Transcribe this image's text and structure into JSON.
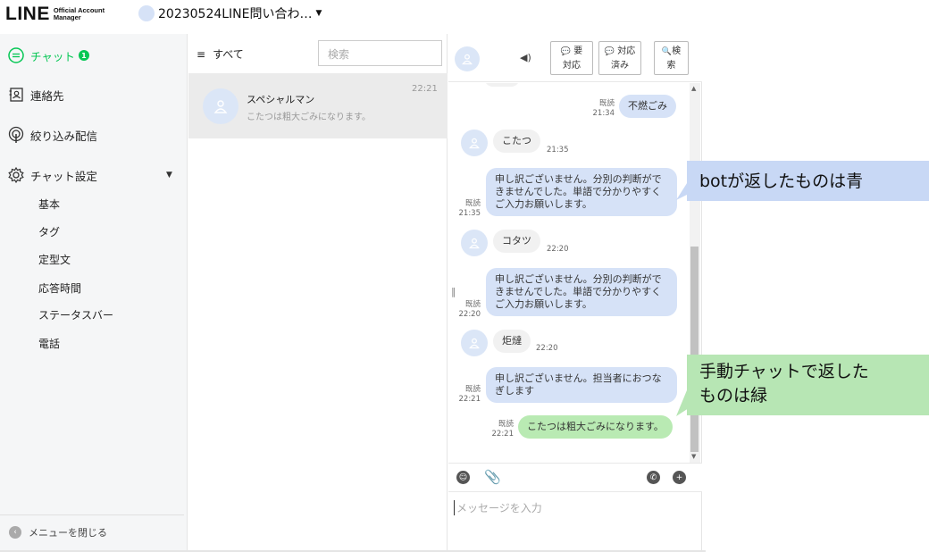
{
  "header": {
    "logo_main": "LINE",
    "logo_sub": "Official Account Manager",
    "account_name": "20230524LINE問い合わ…"
  },
  "sidebar": {
    "chat_label": "チャット",
    "chat_badge": "1",
    "contacts_label": "連絡先",
    "filtered_broadcast_label": "絞り込み配信",
    "chat_settings_label": "チャット設定",
    "sub_items": [
      "基本",
      "タグ",
      "定型文",
      "応答時間",
      "ステータスバー",
      "電話"
    ],
    "close_menu_label": "メニューを閉じる"
  },
  "chatlist": {
    "filter_label": "すべて",
    "search_placeholder": "検索",
    "conversation": {
      "name": "スペシャルマン",
      "preview": "こたつは粗大ごみになります。",
      "time": "22:21"
    }
  },
  "chat": {
    "buttons": {
      "needs_action_1": "要",
      "needs_action_2": "対応",
      "done_1": "対応",
      "done_2": "済み",
      "search_1": "検",
      "search_2": "索"
    },
    "messages": {
      "m1_text": "不燃ごみ",
      "m1_read": "既読",
      "m1_time": "21:34",
      "m2_text": "こたつ",
      "m2_time": "21:35",
      "m3_line1": "申し訳ございません。分別の判断がで",
      "m3_line2": "きませんでした。単語で分かりやすく",
      "m3_line3": "ご入力お願いします。",
      "m3_read": "既読",
      "m3_time": "21:35",
      "m4_text": "コタツ",
      "m4_time": "22:20",
      "m5_line1": "申し訳ございません。分別の判断がで",
      "m5_line2": "きませんでした。単語で分かりやすく",
      "m5_line3": "ご入力お願いします。",
      "m5_read": "既読",
      "m5_time": "22:20",
      "m6_text": "炬燵",
      "m6_time": "22:20",
      "m7_line1": "申し訳ございません。担当者におつな",
      "m7_line2": "ぎします",
      "m7_read": "既読",
      "m7_time": "22:21",
      "m8_text": "こたつは粗大ごみになります。",
      "m8_read": "既読",
      "m8_time": "22:21"
    },
    "input_placeholder": "メッセージを入力"
  },
  "annotations": {
    "bot_blue": "botが返したものは青",
    "manual_green_1": "手動チャットで返した",
    "manual_green_2": "ものは緑"
  },
  "colors": {
    "line_green": "#06c755",
    "bot_bubble": "#d6e2f7",
    "manual_bubble": "#b9eab3",
    "callout_blue": "#c8d8f5",
    "callout_green": "#b7e6b4"
  }
}
